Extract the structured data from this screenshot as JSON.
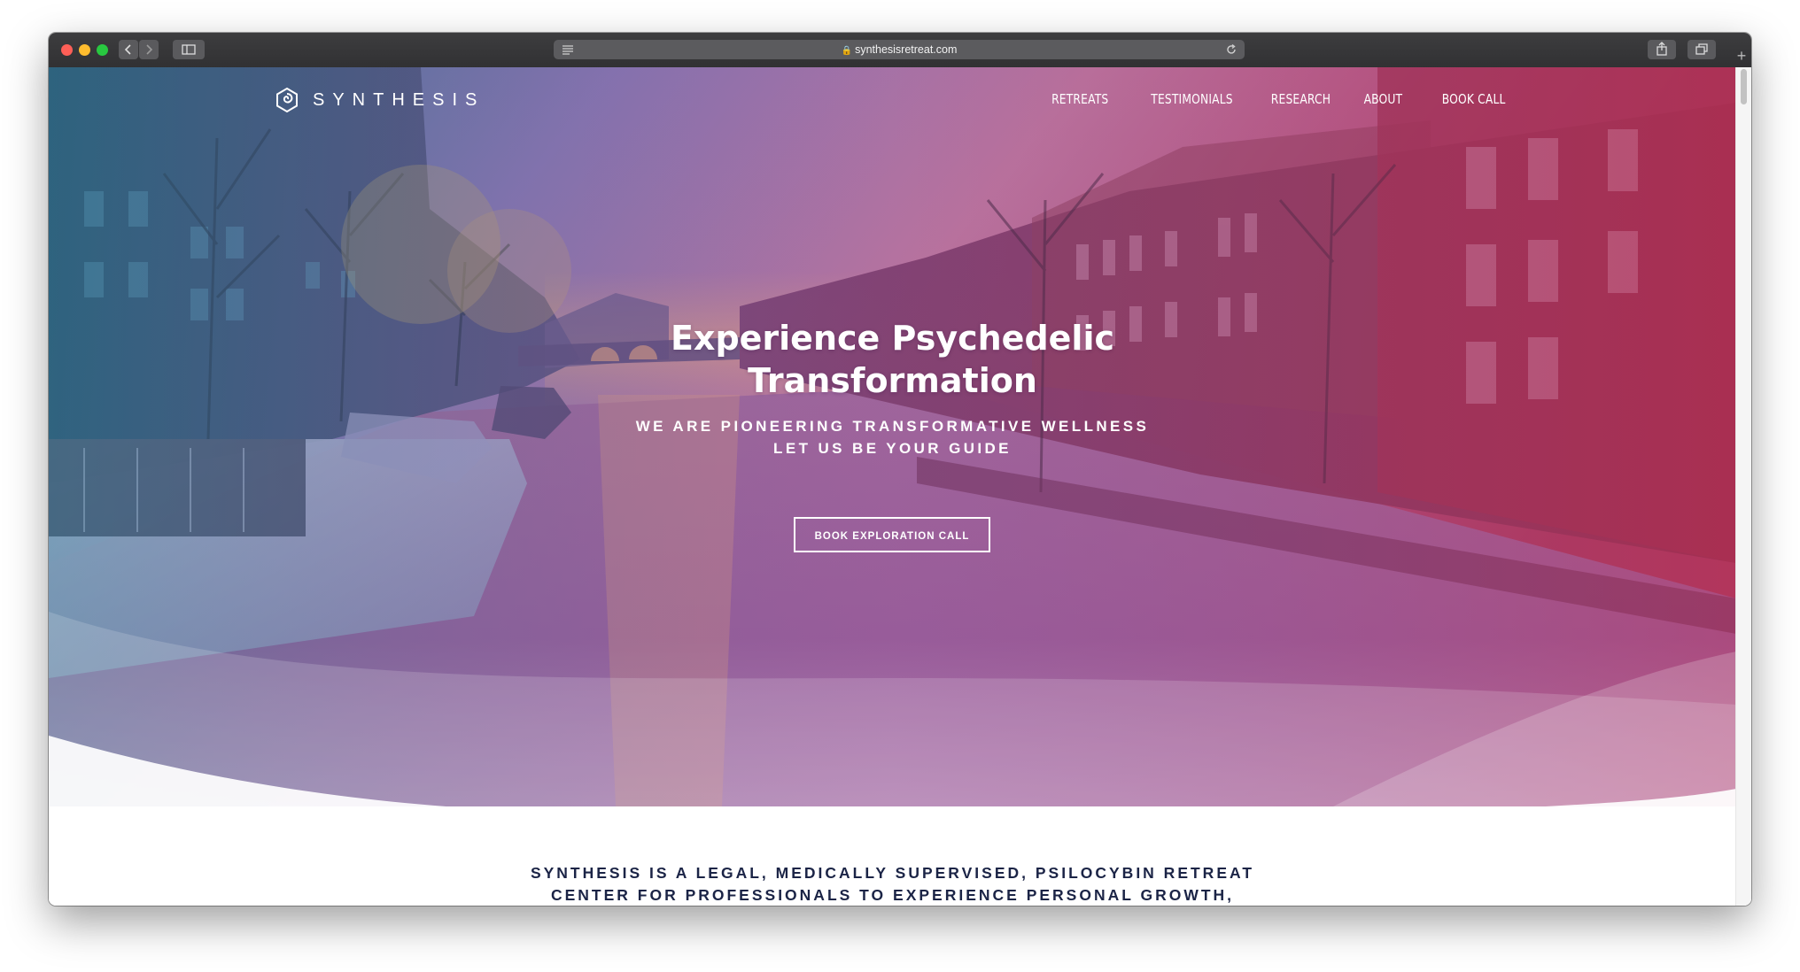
{
  "browser": {
    "url": "synthesisretreat.com",
    "back_icon": "chevron-left-icon",
    "forward_icon": "chevron-right-icon",
    "sidebar_icon": "sidebar-icon",
    "reader_icon": "reader-icon",
    "lock_icon": "lock-icon",
    "reload_icon": "reload-icon",
    "share_icon": "share-icon",
    "tabs_icon": "tabs-icon",
    "new_tab_label": "+"
  },
  "site": {
    "logo_text": "SYNTHESIS",
    "nav": [
      {
        "label": "RETREATS"
      },
      {
        "label": "TESTIMONIALS"
      },
      {
        "label": "RESEARCH"
      },
      {
        "label": "ABOUT"
      },
      {
        "label": "BOOK CALL"
      }
    ]
  },
  "hero": {
    "title_line1": "Experience Psychedelic",
    "title_line2": "Transformation",
    "subtitle_line1": "WE ARE PIONEERING TRANSFORMATIVE WELLNESS",
    "subtitle_line2": "LET US BE YOUR GUIDE",
    "cta_label": "BOOK EXPLORATION CALL"
  },
  "intro": {
    "line1": "SYNTHESIS IS A LEGAL, MEDICALLY SUPERVISED, PSILOCYBIN RETREAT",
    "line2": "CENTER FOR PROFESSIONALS TO EXPERIENCE PERSONAL GROWTH,"
  },
  "colors": {
    "gradient_left": "#3f7f9a",
    "gradient_mid": "#9a5c9a",
    "gradient_right": "#c0476a",
    "intro_text": "#1b2446"
  }
}
